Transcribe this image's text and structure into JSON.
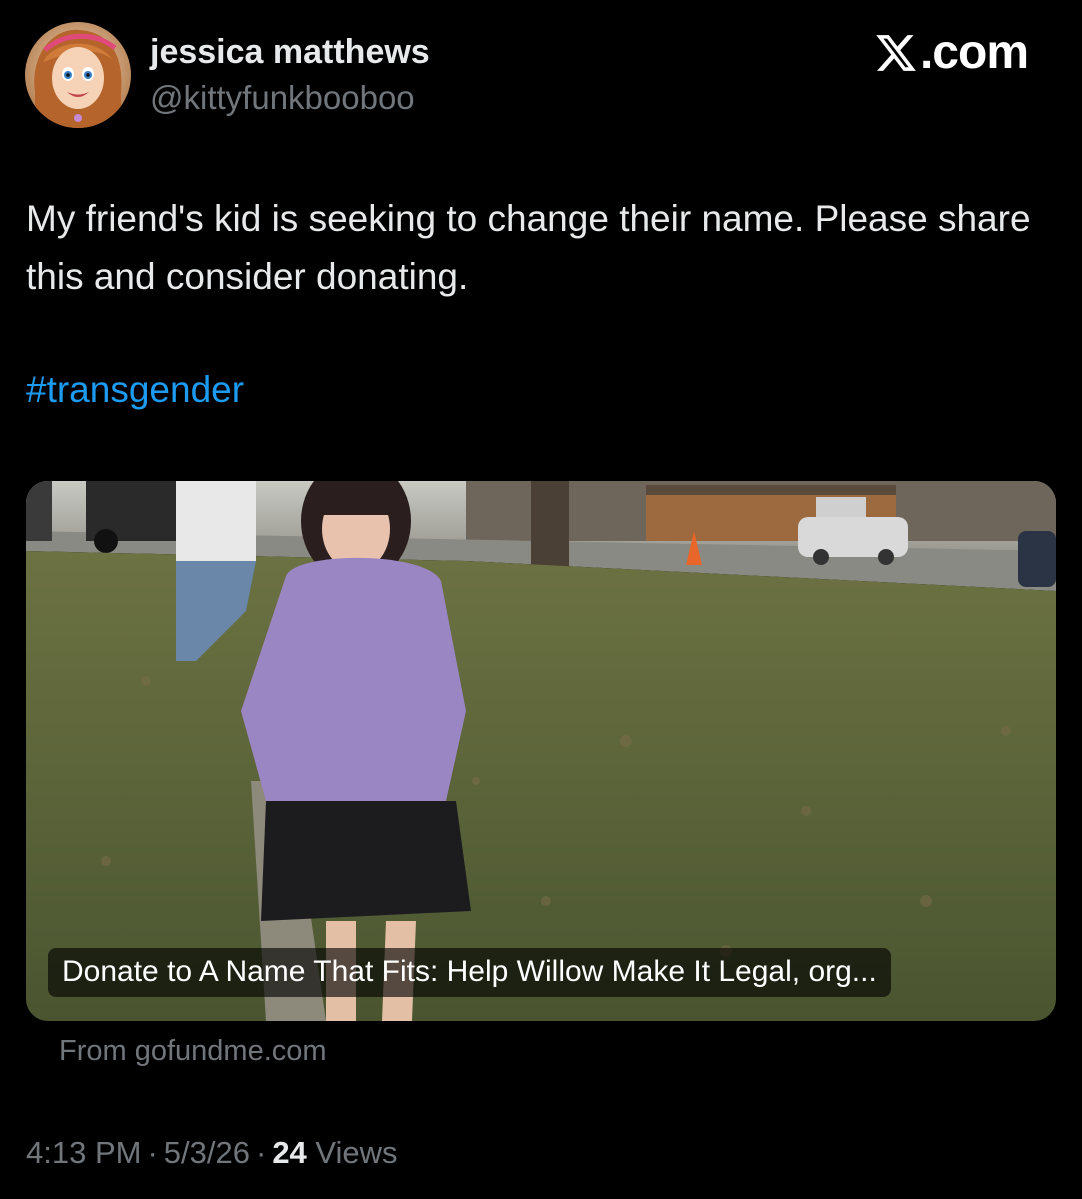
{
  "header": {
    "display_name": "jessica matthews",
    "handle": "@kittyfunkbooboo",
    "brand_suffix": ".com",
    "brand_icon": "x-logo-icon"
  },
  "tweet": {
    "text": "My friend's kid is seeking to change their name. Please share this and consider donating.",
    "hashtag": "#transgender",
    "hashtag_color": "#1d9bf0"
  },
  "card": {
    "title": "Donate to A Name That Fits: Help Willow Make It Legal, org...",
    "source": "From gofundme.com"
  },
  "meta": {
    "time": "4:13 PM",
    "date": "5/3/26",
    "views_count": "24",
    "views_label": "Views",
    "separator": "·"
  },
  "colors": {
    "background": "#000000",
    "primary_text": "#e7e9ea",
    "secondary_text": "#71767b",
    "link": "#1d9bf0"
  }
}
